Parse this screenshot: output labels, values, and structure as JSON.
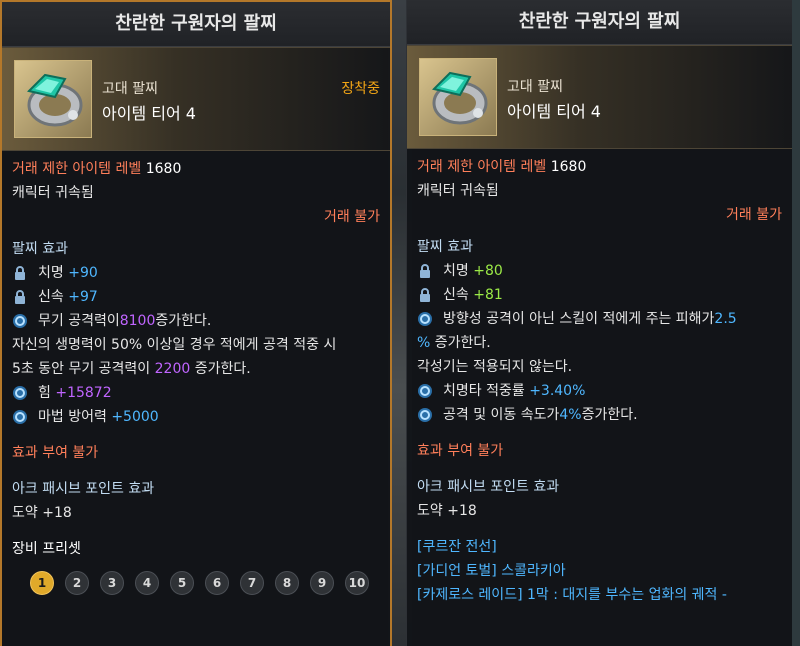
{
  "left": {
    "title": "찬란한 구원자의 팔찌",
    "item_type": "고대 팔찌",
    "item_tier": "아이템 티어 4",
    "equipped_label": "장착중",
    "level_label": "거래 제한 아이템 레벨",
    "level_value": "1680",
    "bound": "캐릭터 귀속됨",
    "trade": "거래 불가",
    "effect_heading": "팔찌 효과",
    "stats": [
      {
        "name": "치명",
        "value": "+90"
      },
      {
        "name": "신속",
        "value": "+97"
      }
    ],
    "effect1_pre": "무기 공격력이 ",
    "effect1_val": "8100",
    "effect1_post": " 증가한다.",
    "effect2_line1": "자신의 생명력이 50% 이상일 경우 적에게 공격 적중 시",
    "effect2_line2_pre": "5초 동안 무기 공격력이 ",
    "effect2_val": "2200",
    "effect2_post": " 증가한다.",
    "power_name": "힘",
    "power_value": "+15872",
    "mdef_name": "마법 방어력",
    "mdef_value": "+5000",
    "no_grant": "효과 부여 불가",
    "ark_heading": "아크 패시브 포인트 효과",
    "ark_value": "도약 +18",
    "preset_heading": "장비 프리셋",
    "presets": [
      "1",
      "2",
      "3",
      "4",
      "5",
      "6",
      "7",
      "8",
      "9",
      "10"
    ]
  },
  "right": {
    "title": "찬란한 구원자의 팔찌",
    "item_type": "고대 팔찌",
    "item_tier": "아이템 티어 4",
    "level_label": "거래 제한 아이템 레벨",
    "level_value": "1680",
    "bound": "캐릭터 귀속됨",
    "trade": "거래 불가",
    "effect_heading": "팔찌 효과",
    "stats": [
      {
        "name": "치명",
        "value": "+80"
      },
      {
        "name": "신속",
        "value": "+81"
      }
    ],
    "effect1_pre": "방향성 공격이 아닌 스킬이 적에게 주는 피해가 ",
    "effect1_val_a": "2.5",
    "effect1_val_b": "%",
    "effect1_post": " 증가한다.",
    "effect1_note": "각성기는 적용되지 않는다.",
    "crit_name": "치명타 적중률",
    "crit_value": "+3.40%",
    "speed_pre": "공격 및 이동 속도가 ",
    "speed_val": "4%",
    "speed_post": " 증가한다.",
    "no_grant": "효과 부여 불가",
    "ark_heading": "아크 패시브 포인트 효과",
    "ark_value": "도약 +18",
    "sources": [
      "[쿠르잔 전선]",
      "[가디언 토벌] 스콜라키아",
      "[카제로스 레이드] 1막 : 대지를 부수는 업화의 궤적 -"
    ]
  },
  "colors": {
    "accent_gold": "#f2a516",
    "border_gold": "#b4782a",
    "red_label": "#ff7f5a",
    "blue_value": "#4fb7ff",
    "purple_value": "#c065ff",
    "green_value": "#9bea47"
  }
}
